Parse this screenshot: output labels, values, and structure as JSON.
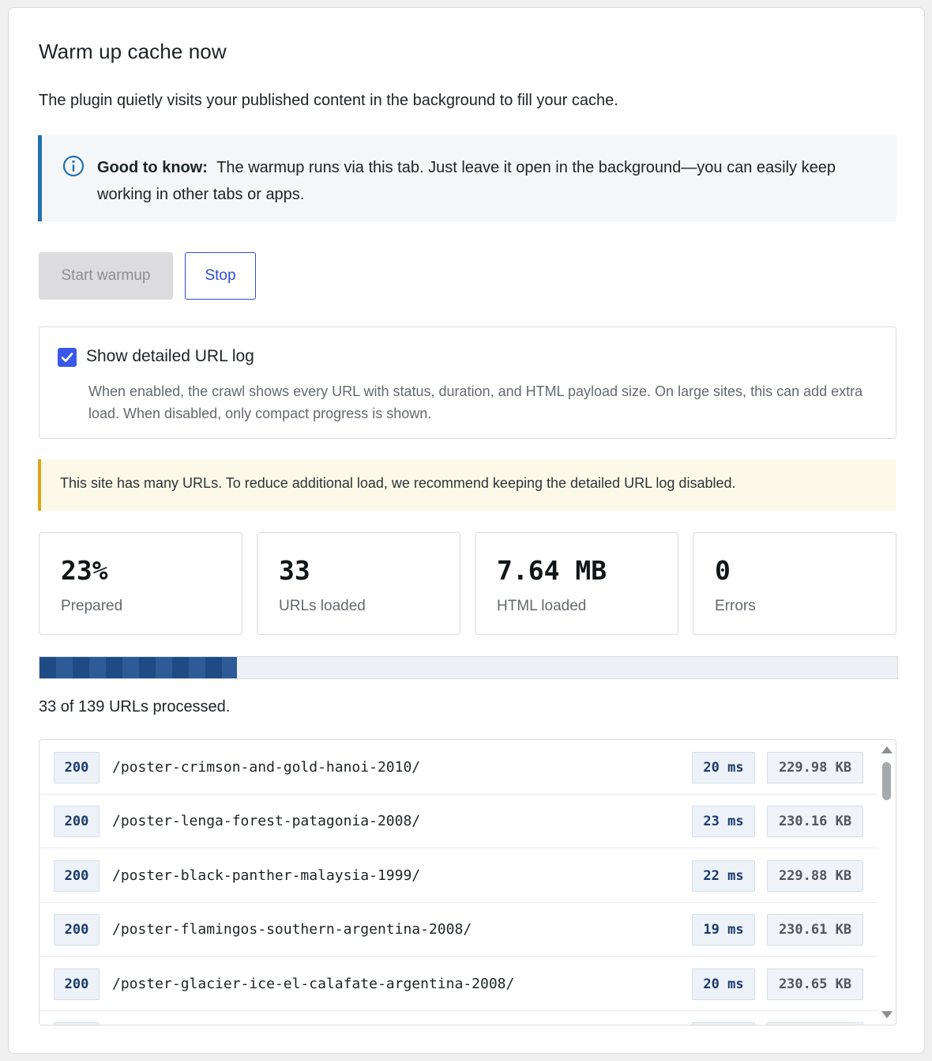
{
  "header": {
    "title": "Warm up cache now",
    "subtitle": "The plugin quietly visits your published content in the background to fill your cache."
  },
  "info_notice": {
    "icon": "info-icon",
    "bold": "Good to know:",
    "text": "The warmup runs via this tab. Just leave it open in the background—you can easily keep working in other tabs or apps."
  },
  "buttons": {
    "start_label": "Start warmup",
    "stop_label": "Stop"
  },
  "detailed_log": {
    "checked": true,
    "label": "Show detailed URL log",
    "description": "When enabled, the crawl shows every URL with status, duration, and HTML payload size. On large sites, this can add extra load. When disabled, only compact progress is shown."
  },
  "warning_notice": {
    "text": "This site has many URLs. To reduce additional load, we recommend keeping the detailed URL log disabled."
  },
  "stats": [
    {
      "value": "23%",
      "label": "Prepared"
    },
    {
      "value": "33",
      "label": "URLs loaded"
    },
    {
      "value": "7.64 MB",
      "label": "HTML loaded"
    },
    {
      "value": "0",
      "label": "Errors"
    }
  ],
  "progress": {
    "fraction": 0.2305,
    "text": "33 of 139 URLs processed."
  },
  "colors": {
    "accent": "#3858e9",
    "info_border": "#2271b1",
    "warn_border": "#dba617",
    "progress_fill": "#1f4b85"
  },
  "url_log": [
    {
      "status": "200",
      "path": "/poster-crimson-and-gold-hanoi-2010/",
      "time": "20 ms",
      "size": "229.98 KB"
    },
    {
      "status": "200",
      "path": "/poster-lenga-forest-patagonia-2008/",
      "time": "23 ms",
      "size": "230.16 KB"
    },
    {
      "status": "200",
      "path": "/poster-black-panther-malaysia-1999/",
      "time": "22 ms",
      "size": "229.88 KB"
    },
    {
      "status": "200",
      "path": "/poster-flamingos-southern-argentina-2008/",
      "time": "19 ms",
      "size": "230.61 KB"
    },
    {
      "status": "200",
      "path": "/poster-glacier-ice-el-calafate-argentina-2008/",
      "time": "20 ms",
      "size": "230.65 KB"
    }
  ]
}
